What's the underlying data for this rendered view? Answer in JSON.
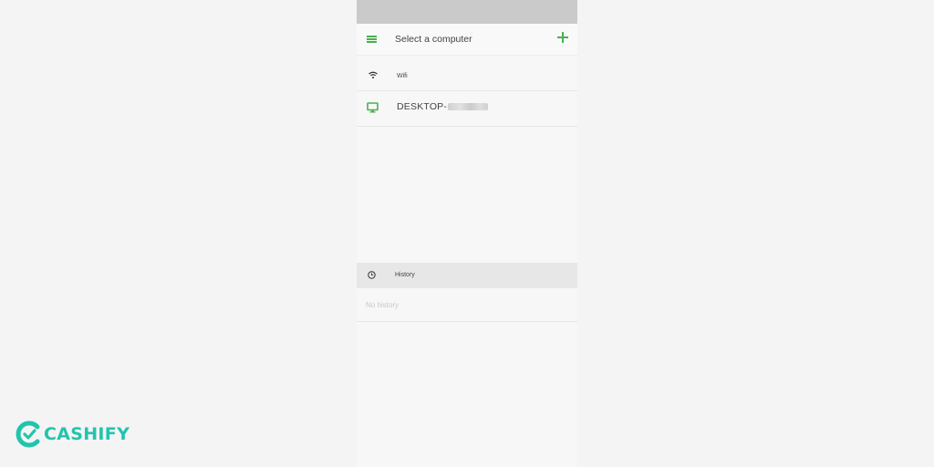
{
  "status_bar": {},
  "app_bar": {
    "title": "Select a computer",
    "menu_icon": "menu-icon",
    "add_icon": "add-icon"
  },
  "network": {
    "icon": "wifi-icon",
    "label": "Wifi"
  },
  "devices": [
    {
      "icon": "monitor-icon",
      "label": "DESKTOP-"
    }
  ],
  "history": {
    "icon": "clock-icon",
    "label": "History",
    "empty_text": "No history"
  },
  "watermark": {
    "text": "CASHIFY",
    "color": "#22c4ad"
  },
  "colors": {
    "accent": "#4caf50",
    "status_bar": "#cacaca",
    "background": "#f4f4f4"
  }
}
